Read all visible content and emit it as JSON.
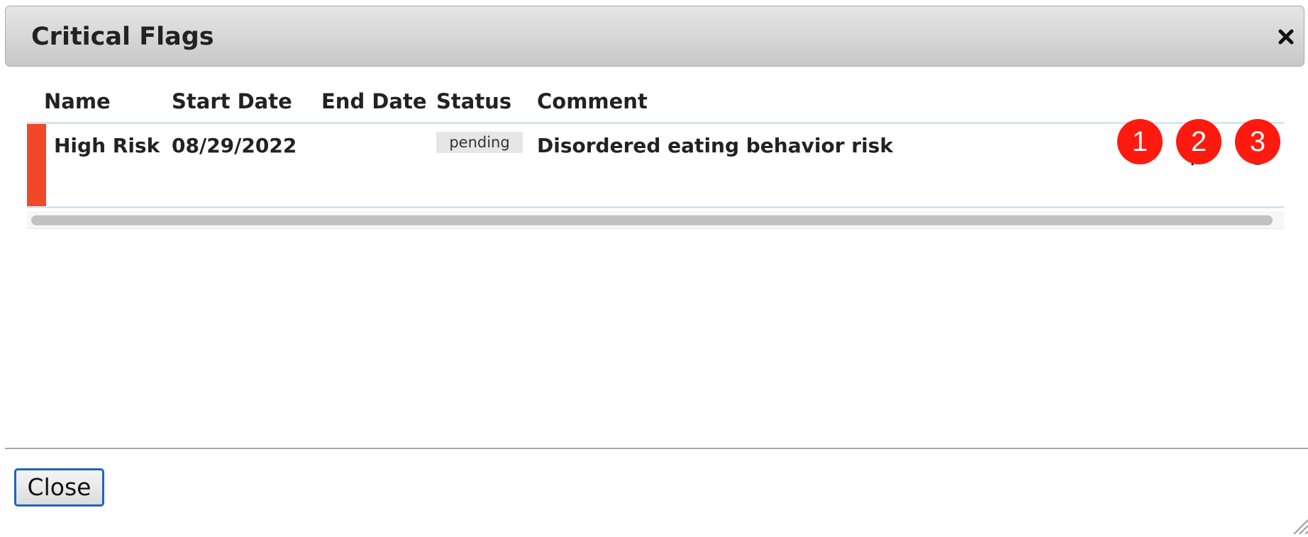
{
  "dialog": {
    "title": "Critical Flags",
    "close_icon": "close-icon"
  },
  "table": {
    "columns": [
      "Name",
      "Start Date",
      "End Date",
      "Status",
      "Comment"
    ],
    "rows": [
      {
        "name": "High Risk",
        "start_date": "08/29/2022",
        "end_date": "",
        "status": "pending",
        "comment": "Disordered eating behavior risk",
        "flag_color": "#f2482a",
        "actions": [
          {
            "icon": "checkmark-icon",
            "marker": "1"
          },
          {
            "icon": "eye-slash-icon",
            "marker": "2"
          },
          {
            "icon": "ban-icon",
            "marker": "3"
          }
        ]
      }
    ]
  },
  "footer": {
    "close_label": "Close"
  },
  "colors": {
    "marker": "#ff1a0f",
    "button_border": "#1f63c4"
  }
}
